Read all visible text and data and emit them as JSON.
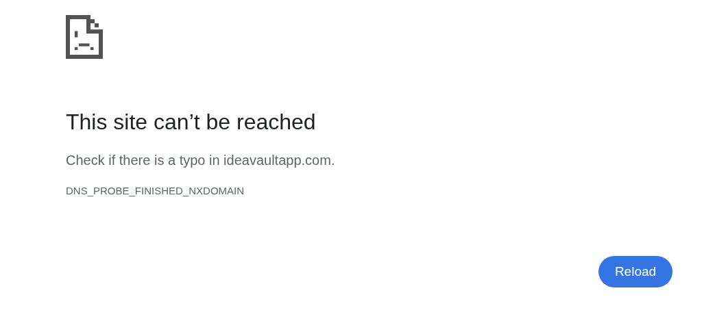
{
  "heading": "This site can’t be reached",
  "message": "Check if there is a typo in ideavaultapp.com.",
  "error_code": "DNS_PROBE_FINISHED_NXDOMAIN",
  "buttons": [
    "Reload"
  ]
}
